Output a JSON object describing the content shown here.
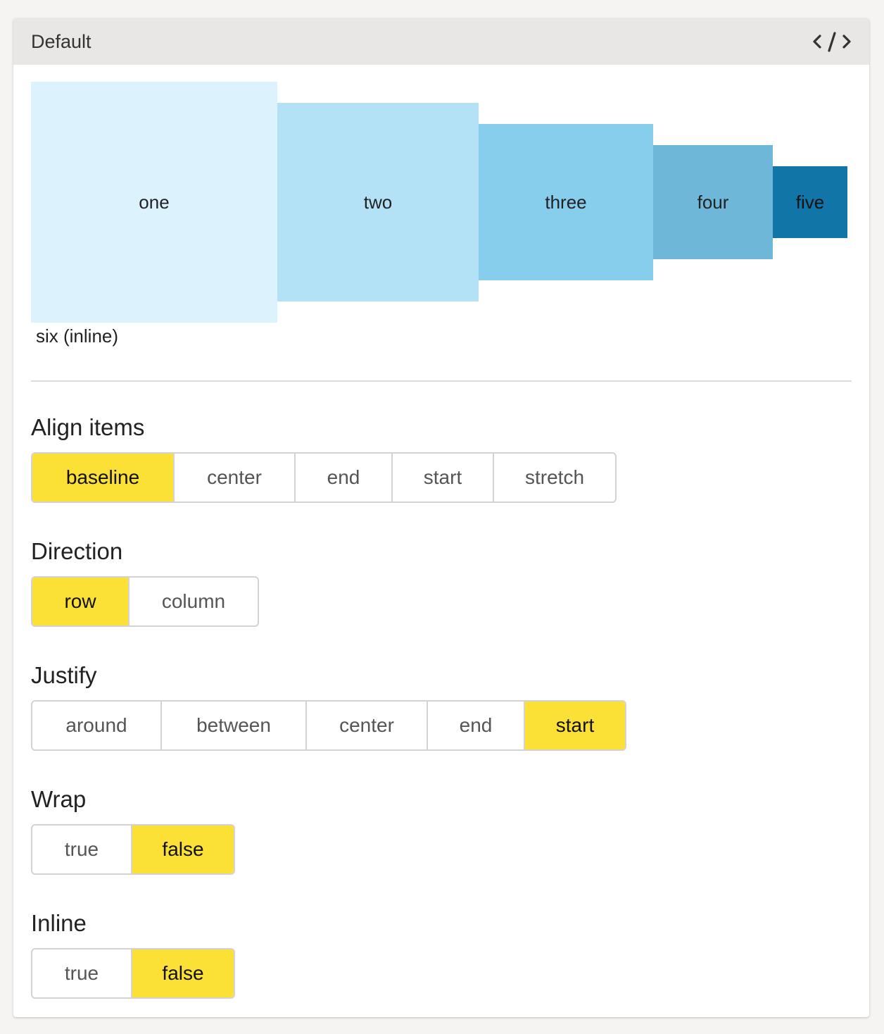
{
  "panel": {
    "title": "Default",
    "code_icon": "code-icon"
  },
  "demo": {
    "boxes": [
      {
        "label": "one",
        "color": "#dcf3fd"
      },
      {
        "label": "two",
        "color": "#b3e2f7"
      },
      {
        "label": "three",
        "color": "#87cdec"
      },
      {
        "label": "four",
        "color": "#6eb7d8"
      },
      {
        "label": "five",
        "color": "#1175a8"
      }
    ],
    "inline_text": "six (inline)"
  },
  "controls": {
    "align_items": {
      "label": "Align items",
      "options": [
        "baseline",
        "center",
        "end",
        "start",
        "stretch"
      ],
      "selected": "baseline"
    },
    "direction": {
      "label": "Direction",
      "options": [
        "row",
        "column"
      ],
      "selected": "row"
    },
    "justify": {
      "label": "Justify",
      "options": [
        "around",
        "between",
        "center",
        "end",
        "start"
      ],
      "selected": "start"
    },
    "wrap": {
      "label": "Wrap",
      "options": [
        "true",
        "false"
      ],
      "selected": "false"
    },
    "inline": {
      "label": "Inline",
      "options": [
        "true",
        "false"
      ],
      "selected": "false"
    }
  },
  "colors": {
    "active": "#fbe035",
    "header_bg": "#e8e7e5"
  }
}
